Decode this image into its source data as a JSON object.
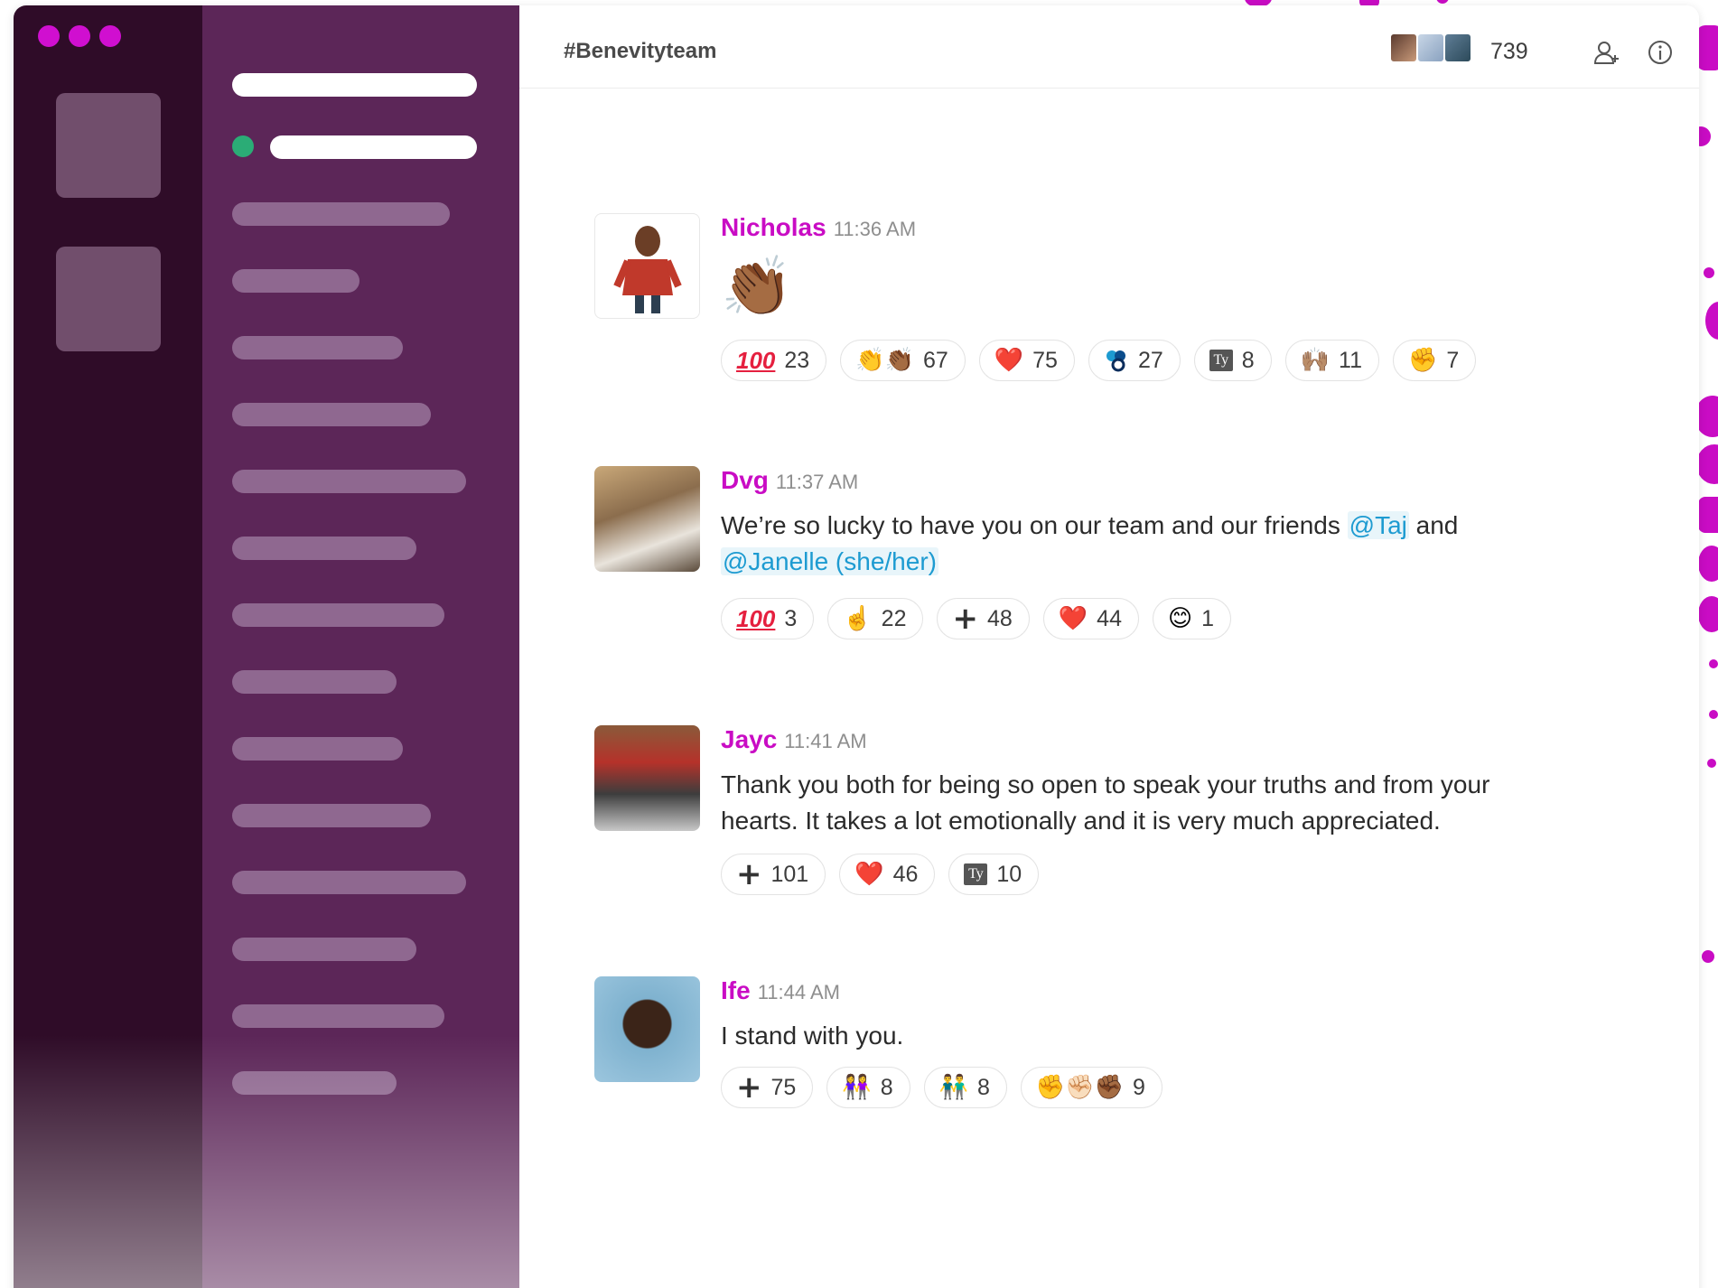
{
  "app": {
    "accent_color": "#c90cc4",
    "rail_color": "#2f0c28",
    "sidebar_color": "#5c2658"
  },
  "header": {
    "channel_name": "#Benevityteam",
    "member_count": "739",
    "add_member_icon": "add-user-icon",
    "info_icon": "info-icon"
  },
  "messages": [
    {
      "author": "Nicholas",
      "time": "11:36 AM",
      "emoji_body": "👏🏾",
      "reactions": [
        {
          "emoji": "💯",
          "count": "23"
        },
        {
          "emoji": "👏👏🏾",
          "count": "67"
        },
        {
          "emoji": "❤️",
          "count": "75"
        },
        {
          "emoji": "benevity",
          "count": "27"
        },
        {
          "emoji": "Ty",
          "count": "8"
        },
        {
          "emoji": "🙌🏽",
          "count": "11"
        },
        {
          "emoji": "✊",
          "count": "7"
        }
      ]
    },
    {
      "author": "Dvg",
      "time": "11:37 AM",
      "text_before": "We’re so lucky to have you on our team and our friends ",
      "mention_1": "@Taj",
      "text_middle": " and",
      "mention_2": "@Janelle (she/her)",
      "reactions": [
        {
          "emoji": "💯",
          "count": "3"
        },
        {
          "emoji": "☝️",
          "count": "22"
        },
        {
          "emoji": "+",
          "count": "48"
        },
        {
          "emoji": "❤️",
          "count": "44"
        },
        {
          "emoji": "😊",
          "count": "1"
        }
      ]
    },
    {
      "author": "Jayc",
      "time": "11:41 AM",
      "text": "Thank you both for being so open to speak your truths and from your hearts. It takes a lot emotionally and it is very much appreciated.",
      "reactions": [
        {
          "emoji": "+",
          "count": "101"
        },
        {
          "emoji": "❤️",
          "count": "46"
        },
        {
          "emoji": "Ty",
          "count": "10"
        }
      ]
    },
    {
      "author": "Ife",
      "time": "11:44 AM",
      "text": "I stand with you.",
      "reactions": [
        {
          "emoji": "+",
          "count": "75"
        },
        {
          "emoji": "👭",
          "count": "8"
        },
        {
          "emoji": "👬",
          "count": "8"
        },
        {
          "emoji": "✊✊🏻✊🏾",
          "count": "9"
        }
      ]
    }
  ]
}
